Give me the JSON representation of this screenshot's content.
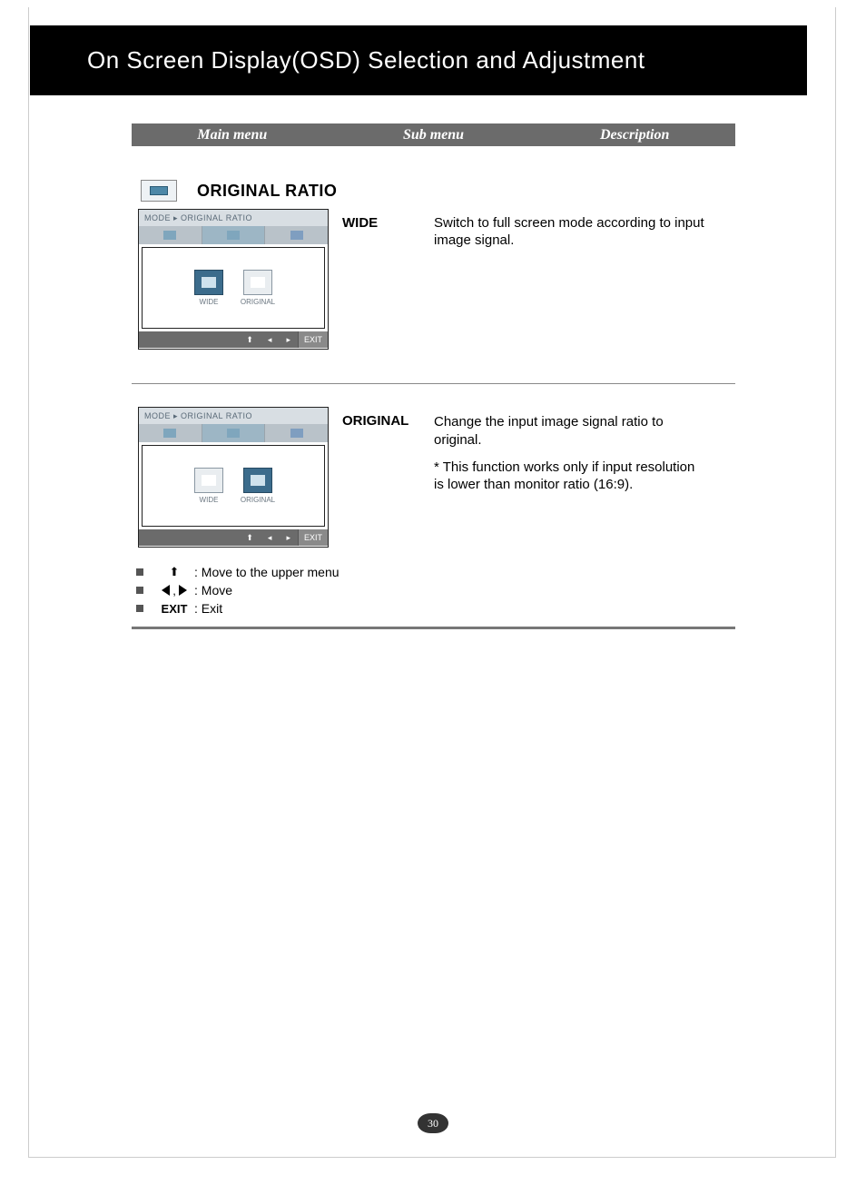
{
  "title": "On Screen Display(OSD) Selection and Adjustment",
  "tabs": {
    "main": "Main menu",
    "sub": "Sub menu",
    "desc": "Description"
  },
  "section": {
    "name": "ORIGINAL RATIO"
  },
  "osd": {
    "breadcrumb": "MODE ▸ ORIGINAL RATIO",
    "opt_wide": "WIDE",
    "opt_original": "ORIGINAL",
    "exit": "EXIT"
  },
  "items": [
    {
      "sub": "WIDE",
      "desc": "Switch to full screen mode according to input image signal."
    },
    {
      "sub": "ORIGINAL",
      "desc": "Change the input image signal ratio to original.",
      "note": "* This function works only if input resolution is lower than monitor ratio (16:9)."
    }
  ],
  "legend": {
    "up": ": Move to the upper menu",
    "move": ": Move",
    "exit_label": "EXIT",
    "exit": ": Exit",
    "comma": ","
  },
  "page_number": "30"
}
